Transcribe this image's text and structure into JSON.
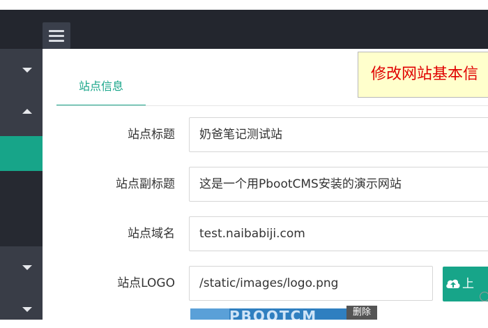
{
  "header": {
    "menu_icon": "hamburger-icon"
  },
  "sidebar": {
    "carets": [
      "chevron-down-icon",
      "chevron-up-icon",
      "chevron-down-icon",
      "chevron-down-icon"
    ],
    "active_color": "#17a589"
  },
  "tabs": [
    {
      "label": "站点信息",
      "active": true
    }
  ],
  "annotation": "修改网站基本信",
  "form": {
    "site_title": {
      "label": "站点标题",
      "value": "奶爸笔记测试站"
    },
    "site_subtitle": {
      "label": "站点副标题",
      "value": "这是一个用PbootCMS安装的演示网站"
    },
    "site_domain": {
      "label": "站点域名",
      "value": "test.naibabiji.com"
    },
    "site_logo": {
      "label": "站点LOGO",
      "value": "/static/images/logo.png"
    }
  },
  "upload_button": {
    "label": "上",
    "icon": "cloud-upload-icon"
  },
  "logo_preview": {
    "text": "PBOOTCM",
    "delete_label": "删除"
  },
  "colors": {
    "accent": "#17a589",
    "topbar": "#23262e",
    "annotation_text": "#e00000"
  }
}
